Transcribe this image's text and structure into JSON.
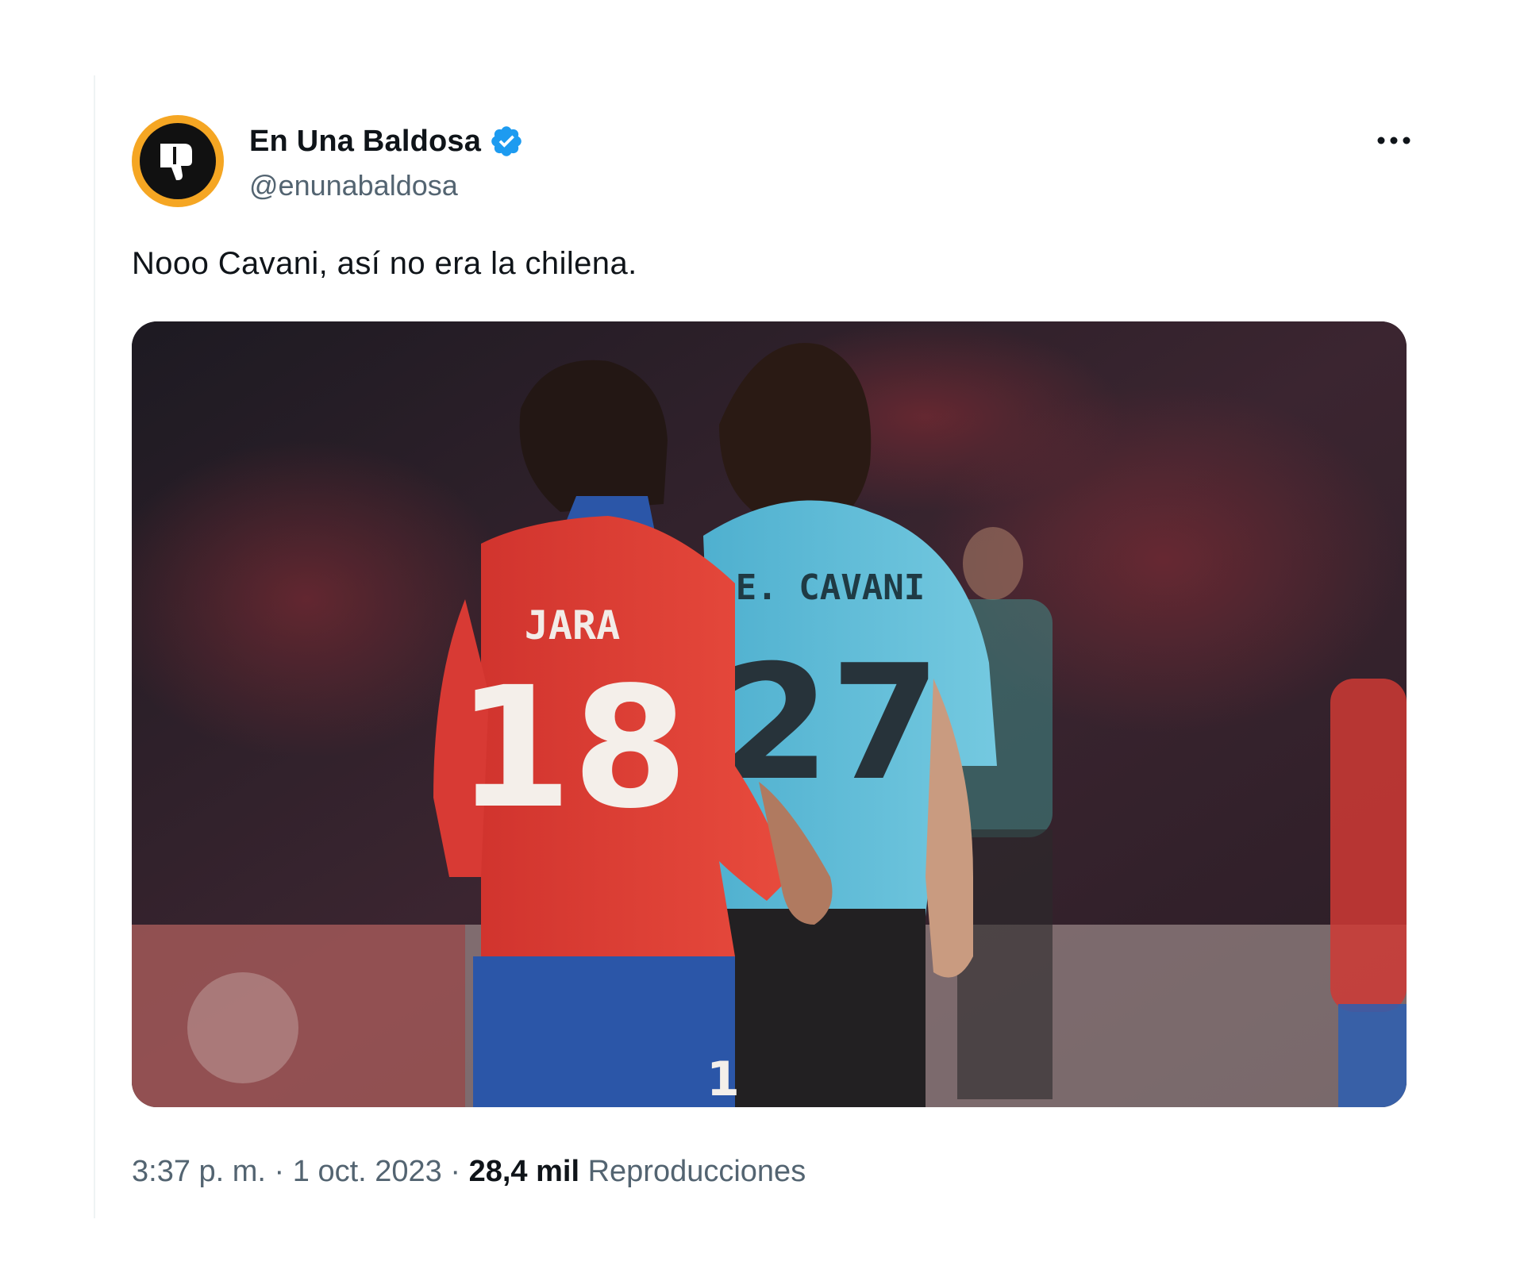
{
  "tweet": {
    "display_name": "En Una Baldosa",
    "handle": "@enunabaldosa",
    "verified_icon": "verified-badge-icon",
    "more_icon": "more-options-icon",
    "text": "Nooo Cavani, así no era la chilena.",
    "media": {
      "jersey_left_name": "JARA",
      "jersey_left_number": "18",
      "jersey_right_name": "E. CAVANI",
      "jersey_right_number": "27",
      "shorts_number": "1"
    },
    "time": "3:37 p. m.",
    "separator": "·",
    "date": "1 oct. 2023",
    "views_count": "28,4 mil",
    "views_label": "Reproducciones"
  },
  "colors": {
    "avatar_ring": "#f5a623",
    "verified": "#1d9bf0",
    "secondary_text": "#536471",
    "primary_text": "#0f1419"
  }
}
